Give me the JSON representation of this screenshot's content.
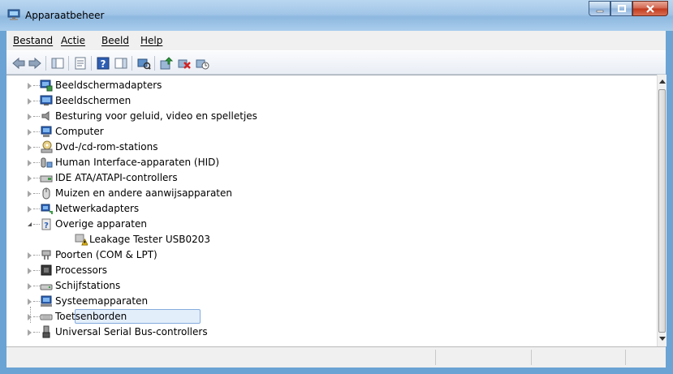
{
  "window": {
    "title": "Apparaatbeheer"
  },
  "menu": [
    {
      "label": "Bestand"
    },
    {
      "label": "Actie"
    },
    {
      "label": "Beeld"
    },
    {
      "label": "Help"
    }
  ],
  "toolbar": [
    {
      "icon": "back-arrow-icon"
    },
    {
      "icon": "forward-arrow-icon"
    },
    {
      "icon": "console-tree-icon"
    },
    {
      "icon": "properties-icon"
    },
    {
      "icon": "help-icon"
    },
    {
      "icon": "action-pane-icon"
    },
    {
      "icon": "scan-hardware-icon"
    },
    {
      "icon": "update-driver-icon"
    },
    {
      "icon": "uninstall-icon"
    },
    {
      "icon": "disable-device-icon"
    }
  ],
  "tree": {
    "items": [
      {
        "label": "Beeldschermadapters",
        "icon": "display-adapter-icon",
        "expanded": false
      },
      {
        "label": "Beeldschermen",
        "icon": "monitor-icon",
        "expanded": false
      },
      {
        "label": "Besturing voor geluid, video en spelletjes",
        "icon": "speaker-icon",
        "expanded": false
      },
      {
        "label": "Computer",
        "icon": "computer-icon",
        "expanded": false
      },
      {
        "label": "Dvd-/cd-rom-stations",
        "icon": "dvd-drive-icon",
        "expanded": false
      },
      {
        "label": "Human Interface-apparaten (HID)",
        "icon": "hid-icon",
        "expanded": false
      },
      {
        "label": "IDE ATA/ATAPI-controllers",
        "icon": "ide-controller-icon",
        "expanded": false
      },
      {
        "label": "Muizen en andere aanwijsapparaten",
        "icon": "mouse-icon",
        "expanded": false
      },
      {
        "label": "Netwerkadapters",
        "icon": "network-adapter-icon",
        "expanded": false
      },
      {
        "label": "Overige apparaten",
        "icon": "unknown-device-icon",
        "expanded": true
      },
      {
        "label": "Leakage Tester USB0203",
        "icon": "warning-device-icon",
        "child": true
      },
      {
        "label": "Poorten (COM & LPT)",
        "icon": "port-icon",
        "expanded": false
      },
      {
        "label": "Processors",
        "icon": "processor-icon",
        "expanded": false
      },
      {
        "label": "Schijfstations",
        "icon": "disk-drive-icon",
        "expanded": false
      },
      {
        "label": "Systeemapparaten",
        "icon": "system-device-icon",
        "expanded": false
      },
      {
        "label": "Toetsenborden",
        "icon": "keyboard-icon",
        "expanded": false
      },
      {
        "label": "Universal Serial Bus-controllers",
        "icon": "usb-icon",
        "expanded": false
      }
    ]
  },
  "colors": {
    "titlebar": "#a2c6e8",
    "selection": "#e3eefb",
    "selection_border": "#84acdd",
    "close": "#c2391c"
  }
}
